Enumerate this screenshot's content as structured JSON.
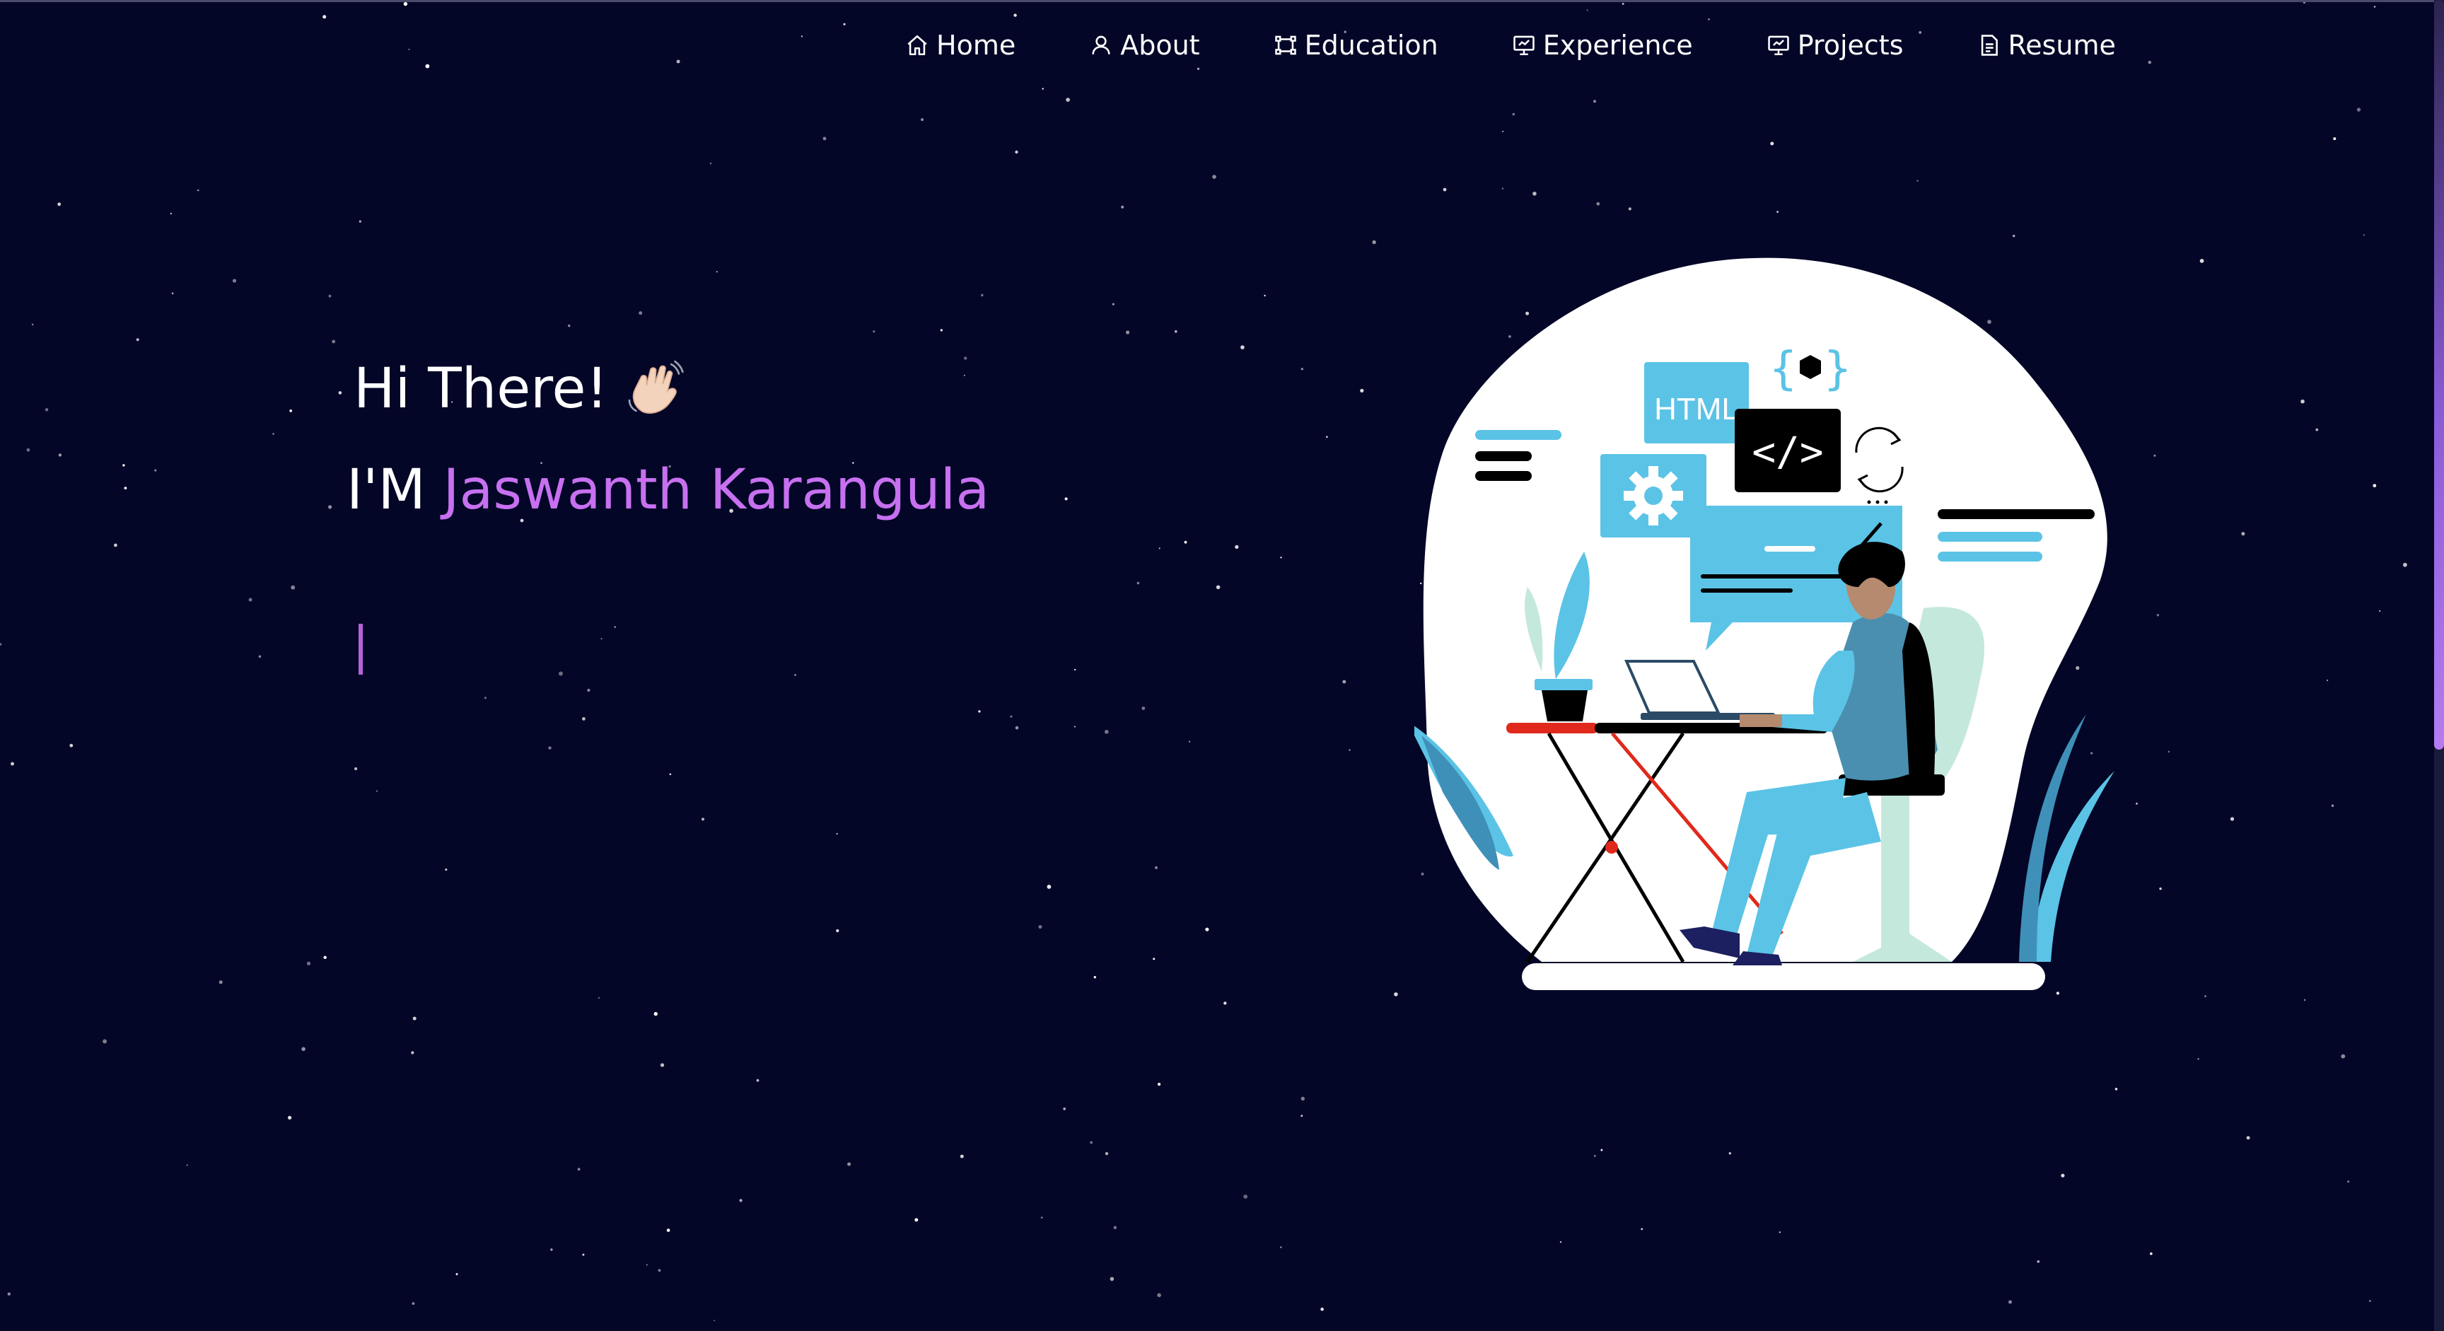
{
  "nav": {
    "items": [
      {
        "label": "Home",
        "icon": "home-icon"
      },
      {
        "label": "About",
        "icon": "user-icon"
      },
      {
        "label": "Education",
        "icon": "education-icon"
      },
      {
        "label": "Experience",
        "icon": "presentation-icon"
      },
      {
        "label": "Projects",
        "icon": "presentation-icon"
      },
      {
        "label": "Resume",
        "icon": "document-icon"
      }
    ]
  },
  "hero": {
    "greeting": "Hi There!",
    "wave_icon": "waving-hand-icon",
    "intro_prefix": "I'M",
    "name": "Jaswanth Karangula"
  },
  "illustration": {
    "html_tag": "HTML",
    "code_symbol": "</>",
    "braces_symbol": "{ }"
  },
  "colors": {
    "background": "#030627",
    "accent": "#c770f0",
    "illustration_blue": "#5bc3e6",
    "text": "#ffffff"
  }
}
